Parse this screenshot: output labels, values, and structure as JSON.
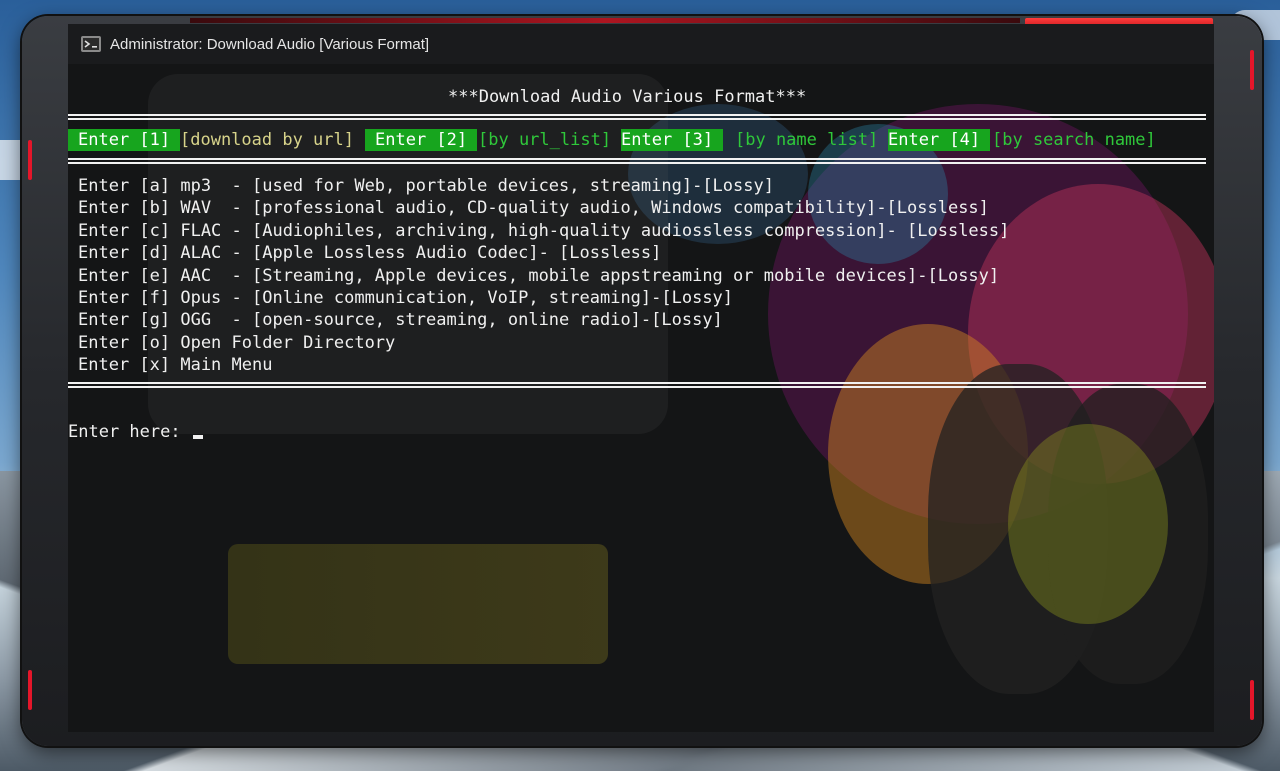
{
  "window": {
    "title": "Administrator:  Download Audio [Various Format]",
    "icon": "terminal-app-icon"
  },
  "console": {
    "heading": "***Download Audio Various Format***",
    "options": [
      {
        "key": "Enter [1]",
        "label": "[download by url]"
      },
      {
        "key": "Enter [2]",
        "label": "[by url_list]"
      },
      {
        "key": "Enter [3]",
        "label": "[by name list]"
      },
      {
        "key": "Enter [4]",
        "label": "[by search name]"
      }
    ],
    "menu": [
      "Enter [a] mp3  - [used for Web, portable devices, streaming]-[Lossy]",
      "Enter [b] WAV  - [professional audio, CD-quality audio, Windows compatibility]-[Lossless]",
      "Enter [c] FLAC - [Audiophiles, archiving, high-quality audiossless compression]- [Lossless]",
      "Enter [d] ALAC - [Apple Lossless Audio Codec]- [Lossless]",
      "Enter [e] AAC  - [Streaming, Apple devices, mobile appstreaming or mobile devices]-[Lossy]",
      "Enter [f] Opus - [Online communication, VoIP, streaming]-[Lossy]",
      "Enter [g] OGG  - [open-source, streaming, online radio]-[Lossy]",
      "Enter [o] Open Folder Directory",
      "Enter [x] Main Menu"
    ],
    "prompt": "Enter here: "
  },
  "colors": {
    "key_bg": "#17a51e",
    "label_amber": "#d7d38a",
    "label_green": "#2fc83a",
    "frame_accent": "#e4162a"
  }
}
